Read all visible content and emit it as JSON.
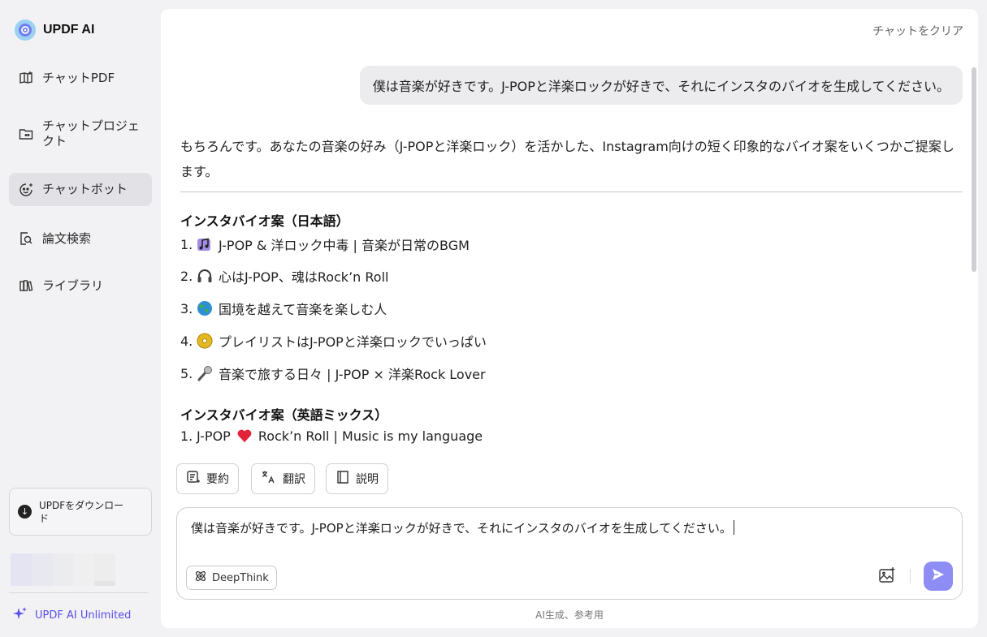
{
  "app": {
    "name": "UPDF AI"
  },
  "sidebar": {
    "items": [
      {
        "label": "チャットPDF",
        "icon": "chat-pdf-icon"
      },
      {
        "label": "チャットプロジェクト",
        "icon": "folder-chat-icon"
      },
      {
        "label": "チャットボット",
        "icon": "chatbot-icon",
        "active": true
      },
      {
        "label": "論文検索",
        "icon": "paper-search-icon"
      },
      {
        "label": "ライブラリ",
        "icon": "library-icon"
      }
    ],
    "download_label": "UPDFをダウンロード",
    "unlimited_label": "UPDF AI Unlimited"
  },
  "chat": {
    "clear_label": "チャットをクリア",
    "user_message": "僕は音楽が好きです。J-POPと洋楽ロックが好きで、それにインスタのバイオを生成してください。",
    "assistant": {
      "intro": "もちろんです。あなたの音楽の好み（J-POPと洋楽ロック）を活かした、Instagram向けの短く印象的なバイオ案をいくつかご提案します。",
      "section1_title": "インスタバイオ案（日本語）",
      "section1_items": [
        {
          "num": "1.",
          "emoji": "music-notes-emoji",
          "text": "J-POP & 洋ロック中毒 | 音楽が日常のBGM"
        },
        {
          "num": "2.",
          "emoji": "headphones-emoji",
          "text": "心はJ-POP、魂はRock’n Roll"
        },
        {
          "num": "3.",
          "emoji": "globe-emoji",
          "text": "国境を越えて音楽を楽しむ人"
        },
        {
          "num": "4.",
          "emoji": "cd-emoji",
          "text": "プレイリストはJ-POPと洋楽ロックでいっぱい"
        },
        {
          "num": "5.",
          "emoji": "microphone-emoji",
          "text": "音楽で旅する日々 | J-POP × 洋楽Rock Lover"
        }
      ],
      "section2_title": "インスタバイオ案（英語ミックス）",
      "section2_items": [
        {
          "num": "1.",
          "text_before": "J-POP",
          "emoji": "heart-emoji",
          "text_after": "Rock’n Roll | Music is my language"
        }
      ]
    },
    "actions": [
      {
        "label": "要約",
        "icon": "summarize-icon"
      },
      {
        "label": "翻訳",
        "icon": "translate-icon"
      },
      {
        "label": "説明",
        "icon": "explain-icon"
      }
    ],
    "input": {
      "value": "僕は音楽が好きです。J-POPと洋楽ロックが好きで、それにインスタのバイオを生成してください。",
      "deepthink_label": "DeepThink"
    },
    "disclaimer": "AI生成、参考用"
  },
  "colors": {
    "accent": "#5a4ee8",
    "send_button": "#8d8df5",
    "sidebar_bg": "#f2f2f4",
    "active_item_bg": "#e2e2e6"
  }
}
